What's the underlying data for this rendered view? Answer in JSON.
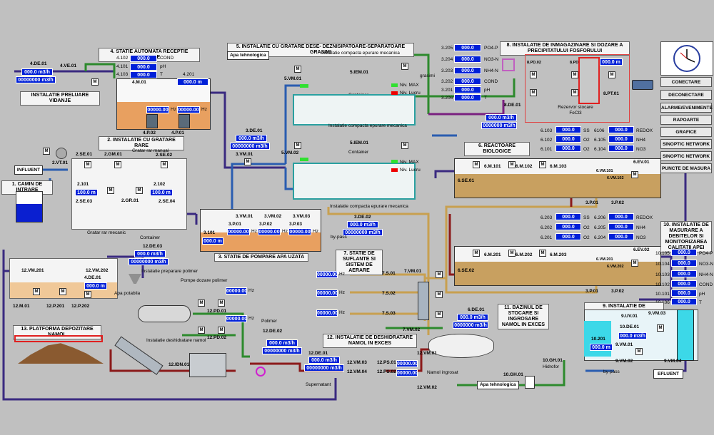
{
  "sections": {
    "s1": "1. CAMIN DE INTRARE",
    "s2": "2. INSTALATIE CU GRATARE RARE",
    "s3": "3. STATIE DE POMPARE APA UZATA",
    "s4": "4. STATIE AUTOMATA RECEPTIE VIDANJE",
    "s5": "5. INSTALATIE CU GRATARE DESE- DEZNISIPATOARE-SEPARATOARE GRASIMI",
    "s6": "6. REACTOARE BIOLOGICE",
    "s7": "7. STATIE DE SUFLANTE SI SISTEM DE AERARE",
    "s8": "8. INSTALATIE DE INMAGAZINARE SI DOZARE A PRECIPITATULUI FOSFORULUI",
    "s9": "9. INSTALATIE DE DEZINFECTIE UV",
    "s10": "10. INSTALATIE DE MASURARE A DEBITELOR SI MONITORIZAREA CALITATII APEI",
    "s11": "11. BAZINUL DE STOCARE SI INGROSARE NAMOL IN EXCES",
    "s12": "12. INSTALATIE DE DESHIDRATARE NAMOL IN EXCES",
    "s13": "13. PLATFORMA DEPOZITARE NAMOL",
    "preluare": "INSTALATIE PRELUARE VIDANJE"
  },
  "flows": {
    "influent": "INFLUENT",
    "efluent": "EFLUENT",
    "apa_tehn1": "Apa tehnologica",
    "apa_tehn2": "Apa tehnologica",
    "apa_potabila": "Apa potabila",
    "supernatant": "Supernatant",
    "namol": "Namol ingrosat",
    "bypass1": "by-pass",
    "bypass2": "by-pass",
    "grasimi": "grasimi"
  },
  "buttons": [
    "CONECTARE",
    "DECONECTARE",
    "ALARME/EVENIMENTE",
    "RAPOARTE",
    "GRAFICE",
    "SINOPTIC NETWORK",
    "SINOPTIC NETWORK",
    "PUNCTE DE MASURA"
  ],
  "vidanje": {
    "tag": "4.DE.01",
    "flow": "000.0 m3/h",
    "total": "00000000 m3/h",
    "ve": "4.VE.01",
    "rows": [
      {
        "id": "4.102",
        "val": "000.0",
        "unit": "COND"
      },
      {
        "id": "4.101",
        "val": "000.0",
        "unit": "pH"
      },
      {
        "id": "4.103",
        "val": "000.0",
        "unit": "T"
      }
    ],
    "level_id": "4.201",
    "level": "000.0 m",
    "tank": "4.M.01",
    "p1": "4.P.01",
    "p2": "4.P.02",
    "hz1": "00000.00",
    "hz2": "00000.00",
    "hz": "Hz"
  },
  "camin": {
    "vt": "2.VT.01"
  },
  "gratare": {
    "se01": "2.SE.01",
    "se02": "2.SE.02",
    "gm01": "2.GM.01",
    "se03": "2.SE.03",
    "se04": "2.SE.04",
    "l101": "2.101",
    "l102": "2.102",
    "v101": "100.0 m",
    "v102": "100.0 m",
    "gr": "2.GR.01",
    "manual": "Gratar rar manual",
    "mecanic": "Gratar rar mecanic",
    "container": "Container"
  },
  "pompare": {
    "de": "3.DE.01",
    "flow": "000.0 m3/h",
    "total": "00000000 m3/h",
    "vm01": "3.VM.01",
    "vm1": "3.VM.01",
    "vm2": "3.VM.02",
    "vm3": "3.VM.03",
    "p1": "3.P.01",
    "p2": "3.P.02",
    "p3": "3.P.03",
    "level_id": "3.101",
    "level": "000.0 m",
    "hz1": "00000.00",
    "hz2": "00000.00",
    "hz3": "00000.00",
    "hz": "Hz"
  },
  "dese": {
    "top": "Instalatie compacta epurare mecanica",
    "iem1": "5.IEM.01",
    "iem2": "5.IEM.01",
    "container": "Container",
    "vm01": "5.VM.01",
    "vm02": "5.VM.02",
    "nivmax": "Niv. MAX",
    "nivlucru": "Niv. Lucru",
    "bot": "Instalatie compacta epurare mecanica",
    "de02": "3.DE.02",
    "flow2": "000.0 m3/h",
    "total2": "00000000 m3/h",
    "bypass": "by-pass"
  },
  "fosfor": {
    "rows": [
      {
        "id": "3.205",
        "val": "000.0",
        "unit": "PO4-P"
      },
      {
        "id": "3.204",
        "val": "000.0",
        "unit": "NO3-N"
      },
      {
        "id": "3.203",
        "val": "000.0",
        "unit": "NH4-N"
      },
      {
        "id": "3.202",
        "val": "000.0",
        "unit": "COND"
      },
      {
        "id": "3.201",
        "val": "000.0",
        "unit": "pH"
      },
      {
        "id": "3.206",
        "val": "000.0",
        "unit": "T"
      }
    ],
    "pd": "8.PD.02",
    "pd2": "8.PD.01",
    "level": "000.0 m",
    "pt": "8.PT.01",
    "fecl": "Rezervor stocare FeCl3",
    "de": "8.DE.01",
    "flow": "000.0 m3/h",
    "total": "0000000 m3/h"
  },
  "bio": {
    "top_left": [
      {
        "id": "6.103",
        "val": "000.0",
        "unit": "SS"
      },
      {
        "id": "6.102",
        "val": "000.0",
        "unit": "O2"
      },
      {
        "id": "6.101",
        "val": "000.0",
        "unit": "O2"
      }
    ],
    "top_right": [
      {
        "id": "6106",
        "val": "000.0",
        "unit": "REDOX"
      },
      {
        "id": "6.105",
        "val": "000.0",
        "unit": "NH4"
      },
      {
        "id": "6.104",
        "val": "000.0",
        "unit": "NO3"
      }
    ],
    "mid_left": [
      {
        "id": "6.203",
        "val": "000.0",
        "unit": "SS"
      },
      {
        "id": "6.202",
        "val": "000.0",
        "unit": "O2"
      },
      {
        "id": "6.201",
        "val": "000.0",
        "unit": "O2"
      }
    ],
    "mid_right": [
      {
        "id": "6.206",
        "val": "000.0",
        "unit": "REDOX"
      },
      {
        "id": "6.205",
        "val": "000.0",
        "unit": "NH4"
      },
      {
        "id": "6.204",
        "val": "000.0",
        "unit": "NO3"
      }
    ],
    "m101": "6.M.101",
    "m102": "6.M.102",
    "m103": "6.M.103",
    "se01": "6.SE.01",
    "ev01": "6.EV.01",
    "m201": "6.M.201",
    "m202": "6.M.202",
    "m203": "6.M.203",
    "se02": "6.SE.02",
    "ev02": "6.EV.02",
    "vm101": "6.VM.101",
    "vm102": "6.VM.102",
    "vm201": "6.VM.201",
    "vm202": "6.VM.202",
    "p01": "3.P.01",
    "p02": "3.P.02",
    "p01b": "3.P.01",
    "p02b": "3.P.02"
  },
  "suflante": {
    "hz1": "00000.00",
    "hz2": "00000.00",
    "hz3": "00000.00",
    "hz": "Hz",
    "s1": "7.S.01",
    "s2": "7.S.02",
    "s3": "7.S.03",
    "vm01": "7.VM.01",
    "vm02": "7.VM.02",
    "de01": "6.DE.01",
    "flow": "000.0 m3/h",
    "total": "0000000 m3/h",
    "ve1": "7.VE.01",
    "ve2": "7.VE.02",
    "ve3": "7.VE.03"
  },
  "calitate": {
    "rows": [
      {
        "id": "10.105",
        "val": "000.0",
        "unit": "PO4-P"
      },
      {
        "id": "10.104",
        "val": "000.0",
        "unit": "NO3-N"
      },
      {
        "id": "10.103",
        "val": "000.0",
        "unit": "NH4-N"
      },
      {
        "id": "10.102",
        "val": "000.0",
        "unit": "COND"
      },
      {
        "id": "10.101",
        "val": "000.0",
        "unit": "pH"
      },
      {
        "id": "10.106",
        "val": "000.0",
        "unit": "T"
      }
    ]
  },
  "uv": {
    "uv01": "9.UV.01",
    "vm03": "9.VM.03",
    "de01": "10.DE.01",
    "flow": "000.0 m3/h",
    "level_id": "10.201",
    "level": "000.0 m",
    "vm02": "9.VM.02",
    "vm01": "9.VM.01",
    "vm04": "9.VM.04"
  },
  "namol": {
    "vm201": "12.VM.201",
    "vm202": "12.VM.202",
    "m01": "12.M.01",
    "p201": "12.P.201",
    "p202": "12.P.202",
    "de01": "4.DE.01",
    "level": "000.0 m",
    "prep": "Instalatie preparare polimer",
    "pompe": "Pompe dozare polimer",
    "hz1": "00000.00",
    "hz2": "00000.00",
    "hz": "Hz",
    "pd01": "12.PD.01",
    "pd02": "12.PD.02",
    "polimer": "Polimer",
    "dezh": "Instalatie deshidratare namol",
    "de02": "12.DE.02",
    "flow02": "000.0 m3/h",
    "total02": "00000000 m3/h",
    "de03": "12.DE.03",
    "flow03": "000.0 m3/h",
    "total03": "00000000 m3/h",
    "idn": "12.IDN.01",
    "de01b": "12.DE.01",
    "flow01": "000.0 m3/h",
    "total01": "00000000 m3/h",
    "vm03": "12.VM.03",
    "vm04": "12.VM.04",
    "ps01": "12.PS.01",
    "ps02": "12.PS.02",
    "hz3": "00000.00",
    "hz4": "00000.00",
    "vm01": "12.VM.01",
    "vm02": "12.VM.02",
    "gh01": "10.GH.01",
    "gh01b": "10.GH.01",
    "hidrofor": "Hidrofor"
  }
}
